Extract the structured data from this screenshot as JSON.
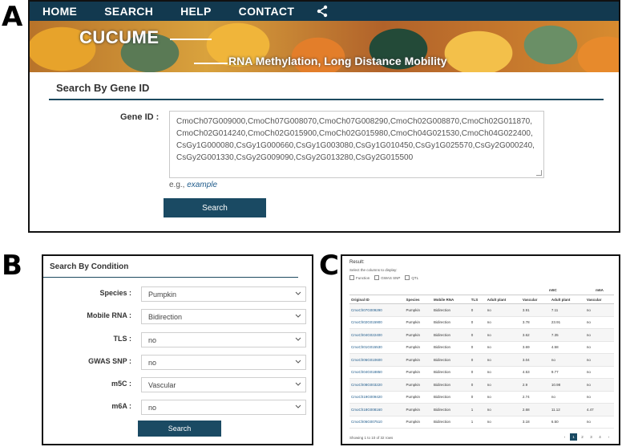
{
  "labels": {
    "a": "A",
    "b": "B",
    "c": "C"
  },
  "nav": {
    "items": [
      "HOME",
      "SEARCH",
      "HELP",
      "CONTACT"
    ],
    "share_icon": "share-icon"
  },
  "banner": {
    "title": "CUCUME",
    "subtitle": "RNA Methylation, Long Distance Mobility"
  },
  "gene_search": {
    "heading": "Search By Gene ID",
    "label": "Gene ID :",
    "value": "CmoCh07G009000,CmoCh07G008070,CmoCh07G008290,CmoCh02G008870,CmoCh02G011870,CmoCh02G014240,CmoCh02G015900,CmoCh02G015980,CmoCh04G021530,CmoCh04G022400,CsGy1G000080,CsGy1G000660,CsGy1G003080,CsGy1G010450,CsGy1G025570,CsGy2G000240,CsGy2G001330,CsGy2G009090,CsGy2G013280,CsGy2G015500",
    "eg_prefix": "e.g.,",
    "eg_link": "example",
    "button": "Search"
  },
  "condition_search": {
    "heading": "Search By Condition",
    "rows": [
      {
        "label": "Species :",
        "value": "Pumpkin"
      },
      {
        "label": "Mobile RNA :",
        "value": "Bidirection"
      },
      {
        "label": "TLS :",
        "value": "no"
      },
      {
        "label": "GWAS SNP :",
        "value": "no"
      },
      {
        "label": "m5C :",
        "value": "Vascular"
      },
      {
        "label": "m6A :",
        "value": "no"
      }
    ],
    "button": "Search"
  },
  "result": {
    "title": "Result:",
    "subtitle": "Select the columns to display:",
    "checkboxes": [
      "Function",
      "GWAS SNP",
      "QTL"
    ],
    "group_headers": {
      "m5c": "m5C",
      "m6a": "m6A"
    },
    "columns": [
      "Original ID",
      "Species",
      "Mobile RNA",
      "TLS",
      "Adult plant",
      "Vascular",
      "Adult plant",
      "Vascular"
    ],
    "rows": [
      [
        "CmoCh07G009290",
        "Pumpkin",
        "Bidirection",
        "0",
        "no",
        "3.91",
        "7.11",
        "no"
      ],
      [
        "CmoCh02G015900",
        "Pumpkin",
        "Bidirection",
        "0",
        "no",
        "3.78",
        "23.91",
        "no"
      ],
      [
        "CmoCh04G022400",
        "Pumpkin",
        "Bidirection",
        "0",
        "no",
        "3.62",
        "7.35",
        "no"
      ],
      [
        "CmoCh01G015530",
        "Pumpkin",
        "Bidirection",
        "0",
        "no",
        "3.69",
        "4.58",
        "no"
      ],
      [
        "CmoCh06G010600",
        "Pumpkin",
        "Bidirection",
        "0",
        "no",
        "3.04",
        "no",
        "no"
      ],
      [
        "CmoCh04G018850",
        "Pumpkin",
        "Bidirection",
        "0",
        "no",
        "4.53",
        "9.77",
        "no"
      ],
      [
        "CmoCh08G003220",
        "Pumpkin",
        "Bidirection",
        "0",
        "no",
        "2.9",
        "10.98",
        "no"
      ],
      [
        "CmoCh19G009420",
        "Pumpkin",
        "Bidirection",
        "0",
        "no",
        "2.74",
        "no",
        "no"
      ],
      [
        "CmoCh18G008160",
        "Pumpkin",
        "Bidirection",
        "1",
        "no",
        "2.68",
        "11.12",
        "4.47"
      ],
      [
        "CmoCh06G007510",
        "Pumpkin",
        "Bidirection",
        "1",
        "no",
        "3.18",
        "6.50",
        "no"
      ]
    ],
    "footer": "Showing 1 to 10 of 32 rows",
    "pager": [
      "‹",
      "1",
      "2",
      "3",
      "4",
      "›"
    ],
    "pager_active": "1"
  },
  "colors": {
    "navy": "#12394f",
    "button": "#1a4a63",
    "link": "#1d5a8a"
  }
}
